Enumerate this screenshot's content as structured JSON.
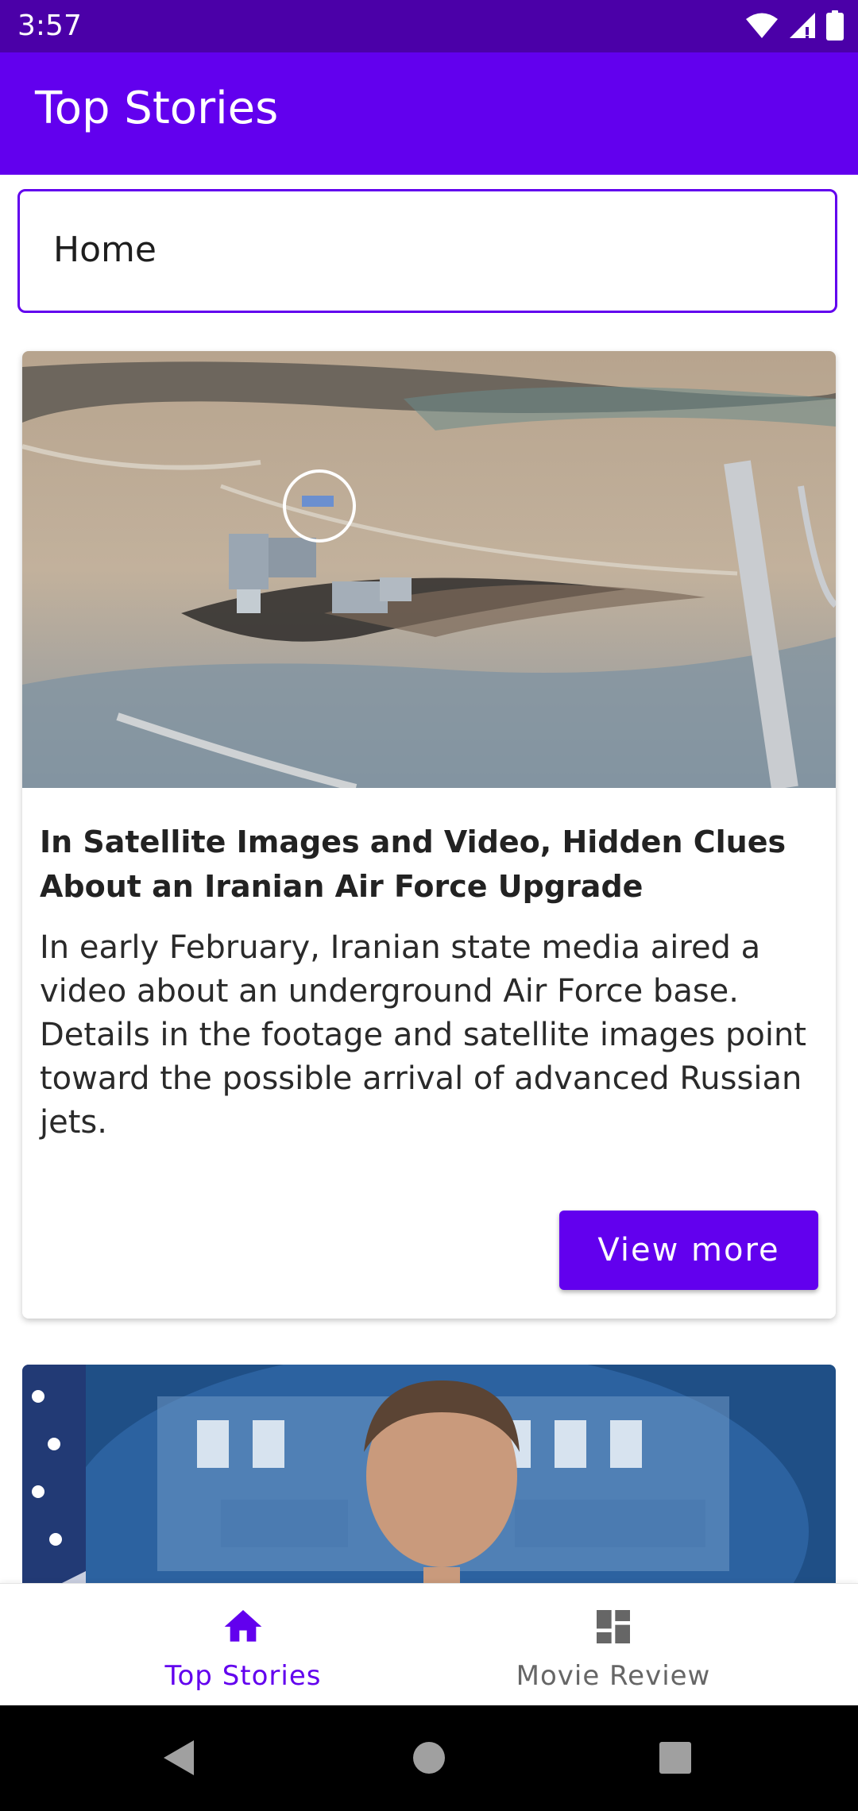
{
  "status_bar": {
    "time": "3:57",
    "icons": [
      "wifi-icon",
      "cell-signal-icon",
      "battery-icon"
    ]
  },
  "app_bar": {
    "title": "Top Stories"
  },
  "section_select": {
    "value": "Home"
  },
  "stories": [
    {
      "title": "In Satellite Images and Video, Hidden Clues About an Iranian Air Force Upgrade",
      "abstract": "In early February, Iranian state media aired a video about an underground Air Force base. Details in the footage and satellite images point toward the possible arrival of advanced Russian jets.",
      "button_label": "View more",
      "image": "satellite-image"
    },
    {
      "image": "press-briefing-photo"
    }
  ],
  "bottom_nav": {
    "items": [
      {
        "label": "Top Stories",
        "icon": "home-icon",
        "selected": true
      },
      {
        "label": "Movie Review",
        "icon": "dashboard-icon",
        "selected": false
      }
    ]
  },
  "system_nav": {
    "buttons": [
      "back-icon",
      "home-circle-icon",
      "recents-icon"
    ]
  },
  "colors": {
    "primary": "#6200ee",
    "status_bar": "#4b00a8",
    "inactive": "#666666"
  }
}
